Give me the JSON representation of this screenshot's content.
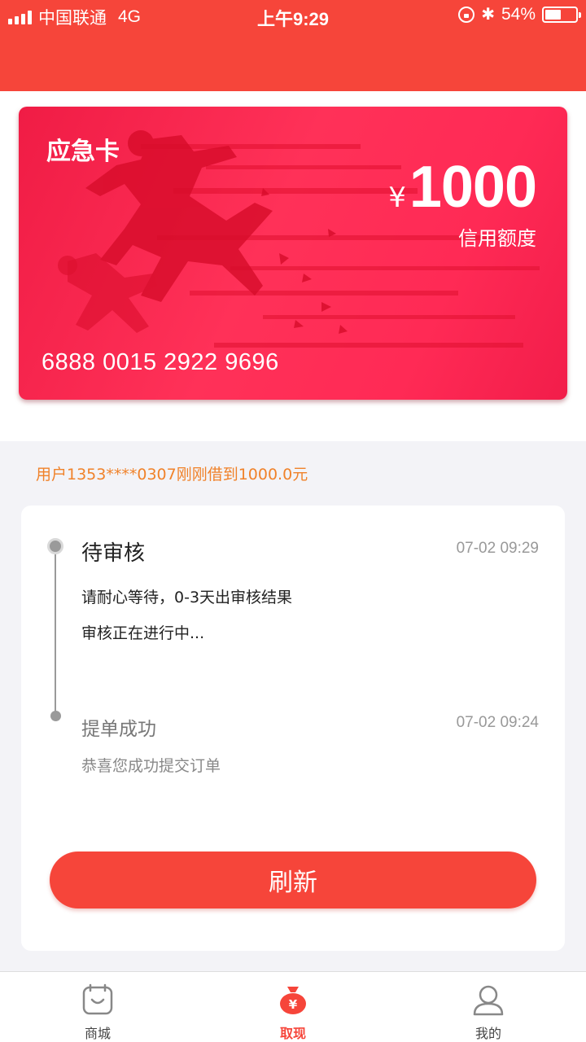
{
  "status_bar": {
    "carrier": "中国联通",
    "network": "4G",
    "time": "上午9:29",
    "battery": "54%",
    "battery_level": 0.54
  },
  "card": {
    "name": "应急卡",
    "currency": "¥",
    "amount": "1000",
    "limit_label": "信用额度",
    "number": "6888 0015 2922 9696"
  },
  "marquee": "用户1353****0307刚刚借到1000.0元",
  "timeline": {
    "steps": [
      {
        "title": "待审核",
        "time": "07-02 09:29",
        "lines": [
          "请耐心等待，0-3天出审核结果",
          "审核正在进行中..."
        ]
      },
      {
        "title": "提单成功",
        "time": "07-02 09:24",
        "lines": [
          "恭喜您成功提交订单"
        ]
      }
    ]
  },
  "refresh_label": "刷新",
  "tabs": [
    {
      "label": "商城",
      "icon": "shop-bag-icon",
      "active": false
    },
    {
      "label": "取现",
      "icon": "money-bag-icon",
      "active": true
    },
    {
      "label": "我的",
      "icon": "user-icon",
      "active": false
    }
  ],
  "colors": {
    "brand": "#f6453a",
    "card": "#ff2a55",
    "marquee": "#f0822a"
  }
}
